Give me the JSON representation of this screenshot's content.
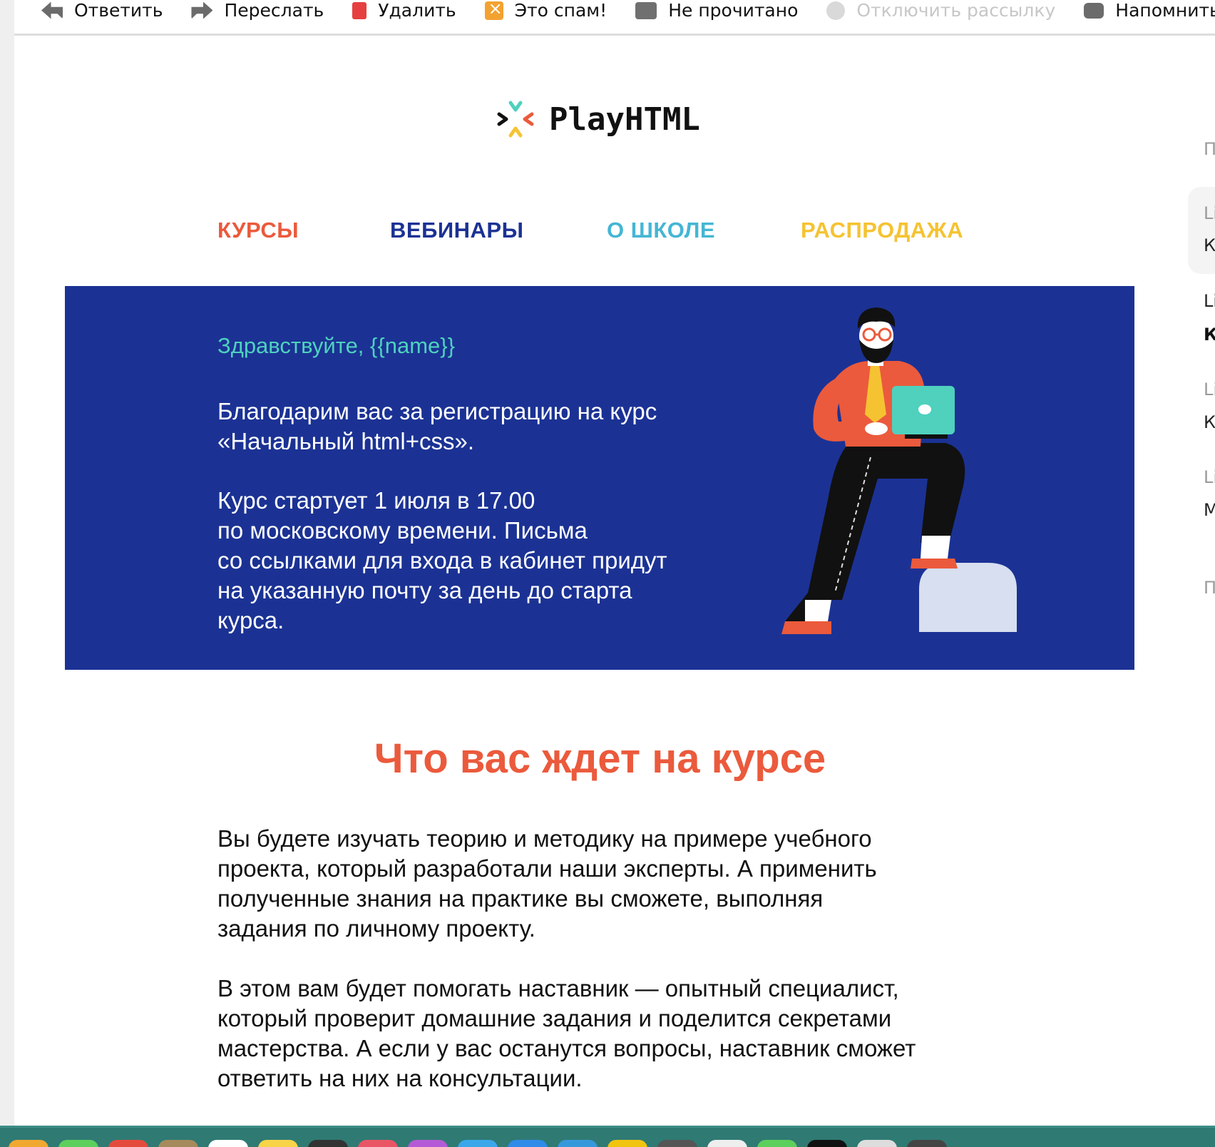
{
  "toolbar": {
    "items": [
      {
        "label": "Ответить",
        "icon": "reply-icon"
      },
      {
        "label": "Переслать",
        "icon": "forward-icon"
      },
      {
        "label": "Удалить",
        "icon": "trash-icon"
      },
      {
        "label": "Это спам!",
        "icon": "spam-icon"
      },
      {
        "label": "Не прочитано",
        "icon": "unread-icon"
      },
      {
        "label": "Отключить рассылку",
        "icon": "unsubscribe-icon",
        "disabled": true
      },
      {
        "label": "Напомнить по",
        "icon": "remind-icon"
      }
    ]
  },
  "side": {
    "items": [
      "П",
      "Li",
      "К",
      "Li",
      "К",
      "Li",
      "К",
      "Li",
      "М",
      "П"
    ]
  },
  "logo": {
    "text": "PlayHTML"
  },
  "nav": {
    "items": [
      {
        "label": "КУРСЫ",
        "color": "#eb5a3c"
      },
      {
        "label": "ВЕБИНАРЫ",
        "color": "#1b3294"
      },
      {
        "label": "О ШКОЛЕ",
        "color": "#45b6d3"
      },
      {
        "label": "РАСПРОДАЖА",
        "color": "#f5c332"
      }
    ]
  },
  "hero": {
    "greeting": "Здравствуйте, {{name}}",
    "p1": "Благодарим вас за регистрацию на курс\n«Начальный html+css».",
    "p2": "Курс стартует 1 июля в 17.00\nпо московскому времени. Письма\nсо ссылками для входа в кабинет придут\nна указанную почту за день до старта\nкурса."
  },
  "section": {
    "title": "Что вас ждет на курсе",
    "p1": "Вы будете изучать теорию и методику на примере учебного\nпроекта, который разработали наши эксперты. А применить\nполученные знания на практике вы сможете, выполняя\nзадания по личному проекту.",
    "p2": "В этом вам будет помогать наставник — опытный специалист,\nкоторый проверит домашние задания и поделится секретами\nмастерства. А если у вас останутся вопросы, наставник сможет\nответить на них на консультации."
  },
  "colors": {
    "hero_bg": "#1b3294",
    "accent_red": "#eb5a3c",
    "accent_teal": "#4fd1be",
    "accent_yellow": "#f5c332"
  }
}
